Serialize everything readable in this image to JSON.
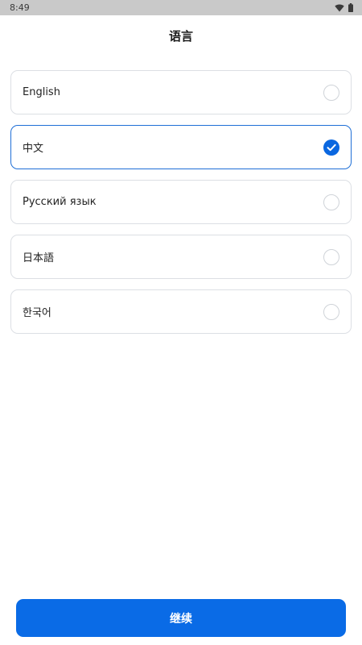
{
  "status_bar": {
    "time": "8:49",
    "icons": [
      "wifi-icon",
      "battery-icon"
    ]
  },
  "header": {
    "title": "语言"
  },
  "languages": [
    {
      "label": "English",
      "selected": false
    },
    {
      "label": "中文",
      "selected": true
    },
    {
      "label": "Русский язык",
      "selected": false
    },
    {
      "label": "日本語",
      "selected": false
    },
    {
      "label": "한국어",
      "selected": false
    }
  ],
  "footer": {
    "continue_label": "继续"
  },
  "colors": {
    "accent": "#0a6be6",
    "selected_border": "#1f6fd6",
    "status_bar_bg": "#c9c9c9"
  }
}
